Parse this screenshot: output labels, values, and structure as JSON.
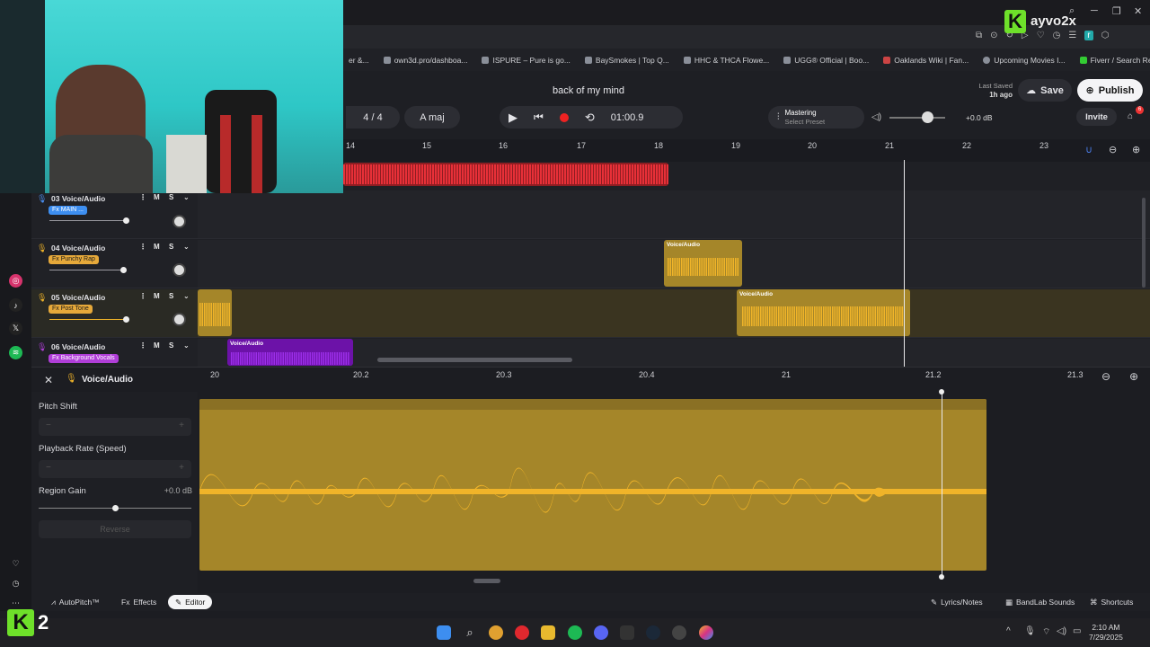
{
  "overlay": {
    "brand_text": "ayvo2x",
    "k2_number": "2"
  },
  "bookmarks": [
    {
      "label": "er &..."
    },
    {
      "label": "own3d.pro/dashboa..."
    },
    {
      "label": "ISPURE – Pure is go..."
    },
    {
      "label": "BaySmokes | Top Q..."
    },
    {
      "label": "HHC & THCA Flowe..."
    },
    {
      "label": "UGG® Official | Boo..."
    },
    {
      "label": "Oaklands Wiki | Fan..."
    },
    {
      "label": "Upcoming Movies I..."
    },
    {
      "label": "Fiverr / Search Resul..."
    }
  ],
  "header": {
    "song_title": "back of my mind",
    "time_signature": "4 / 4",
    "key": "A maj",
    "time_display": "01:00.9",
    "mastering_label": "Mastering",
    "mastering_preset": "Select Preset",
    "master_gain": "+0.0 dB",
    "last_saved_label": "Last Saved",
    "last_saved_time": "1h ago",
    "save_label": "Save",
    "publish_label": "Publish",
    "invite_label": "Invite",
    "notification_count": "6"
  },
  "ruler": {
    "labels": [
      "14",
      "15",
      "16",
      "17",
      "18",
      "19",
      "20",
      "21",
      "22",
      "23"
    ]
  },
  "tracks": [
    {
      "name": "03  Voice/Audio",
      "fx": "Fx  MAIN ...",
      "fx_color": "#3d8ef0",
      "m": "M",
      "s": "S",
      "pan_l": "L",
      "pan_r": "R"
    },
    {
      "name": "04  Voice/Audio",
      "fx": "Fx  Punchy Rap",
      "fx_color": "#e6a93a",
      "m": "M",
      "s": "S",
      "pan_l": "L",
      "pan_r": "R"
    },
    {
      "name": "05  Voice/Audio",
      "fx": "Fx  Post Tone",
      "fx_color": "#e6a93a",
      "m": "M",
      "s": "S",
      "pan_l": "L",
      "pan_r": "R"
    },
    {
      "name": "06  Voice/Audio",
      "fx": "Fx  Background Vocals",
      "fx_color": "#b03ed8",
      "m": "M",
      "s": "S",
      "pan_l": "L",
      "pan_r": "R"
    }
  ],
  "regions": {
    "track4_label": "Voice/Audio",
    "track5_label": "Voice/Audio",
    "track6_label": "Voice/Audio"
  },
  "editor": {
    "title": "Voice/Audio",
    "pitch_shift_label": "Pitch Shift",
    "playback_rate_label": "Playback Rate (Speed)",
    "region_gain_label": "Region Gain",
    "region_gain_value": "+0.0 dB",
    "reverse_label": "Reverse",
    "ruler_labels": [
      "20",
      "20.2",
      "20.3",
      "20.4",
      "21",
      "21.2",
      "21.3"
    ]
  },
  "bottombar": {
    "autopitch_label": "AutoPitch™",
    "effects_label": "Effects",
    "editor_label": "Editor",
    "lyrics_label": "Lyrics/Notes",
    "bandlab_sounds_label": "BandLab Sounds",
    "shortcuts_label": "Shortcuts"
  },
  "taskbar": {
    "time": "2:10 AM",
    "date": "7/29/2025"
  },
  "colors": {
    "accent_yellow": "#f0b429",
    "region_red": "#d4282c",
    "region_purple": "#8b1bd6",
    "region_yellow": "#a58629"
  }
}
